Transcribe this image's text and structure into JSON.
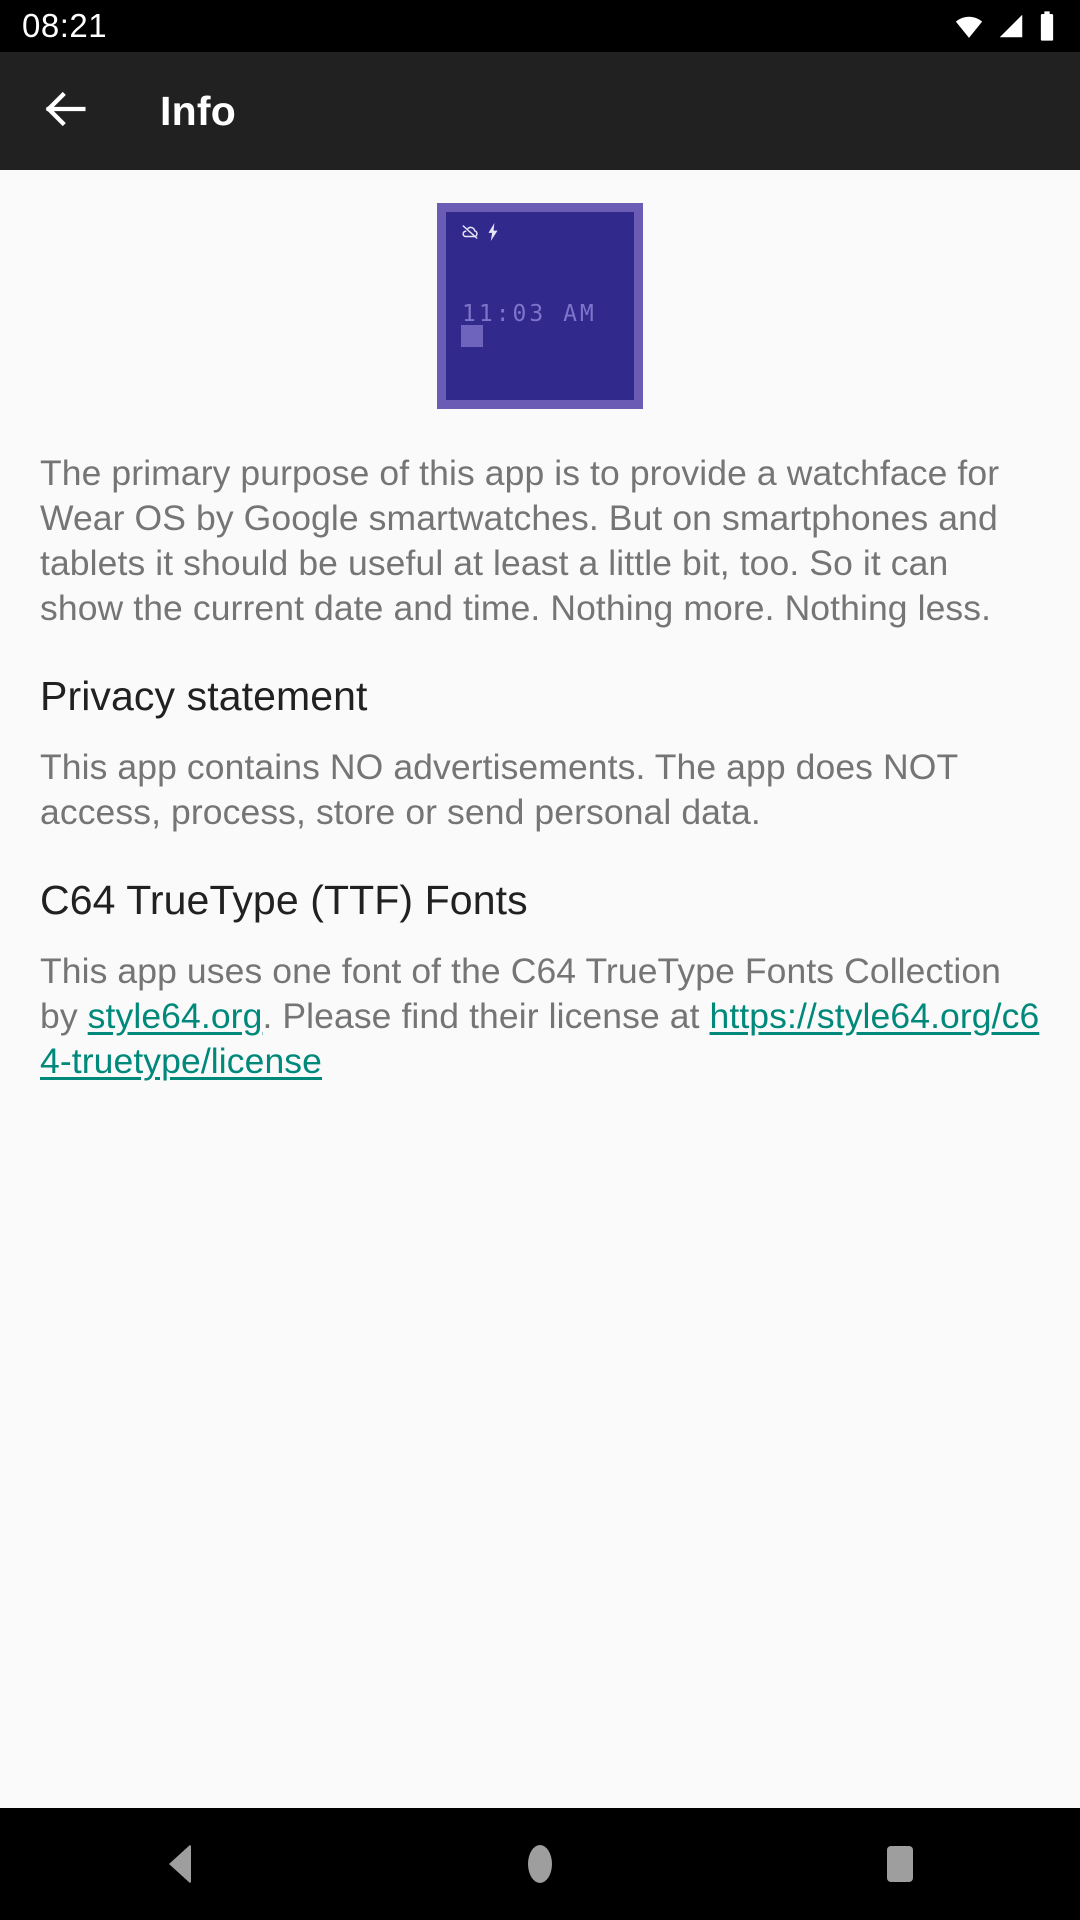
{
  "status_bar": {
    "time": "08:21",
    "icons": [
      "wifi-icon",
      "cellular-signal-icon",
      "battery-icon"
    ]
  },
  "app_bar": {
    "back_icon": "arrow-back-icon",
    "title": "Info"
  },
  "watchface_preview": {
    "icons": [
      "cloud-off-icon",
      "bolt-icon"
    ],
    "time": "11:03 AM",
    "border_color": "#6a5cb5",
    "screen_color": "#312a8c",
    "time_color": "#7e74c9"
  },
  "content": {
    "intro": "The primary purpose of this app is to provide a watchface for Wear OS by Google smartwatches. But on smartphones and tablets it should be useful at least a little bit, too. So it can show the current date and time. Nothing more. Nothing less.",
    "privacy": {
      "heading": "Privacy statement",
      "body": "This app contains NO advertisements. The app does NOT access, process, store or send personal data."
    },
    "fonts": {
      "heading": "C64 TrueType (TTF) Fonts",
      "body_part1": "This app uses one font of the C64 TrueType Fonts Collection by ",
      "link1_text": "style64.org",
      "body_part2": ". Please find their license at ",
      "link2_text": "https://style64.org/c64-truetype/license"
    }
  },
  "nav_bar": {
    "back_label": "back-button",
    "home_label": "home-button",
    "recents_label": "recents-button"
  },
  "colors": {
    "app_bar_bg": "#212121",
    "content_bg": "#fafafa",
    "body_text": "#757575",
    "heading_text": "#212121",
    "link": "#00897b",
    "nav_icon": "#9e9e9e"
  }
}
